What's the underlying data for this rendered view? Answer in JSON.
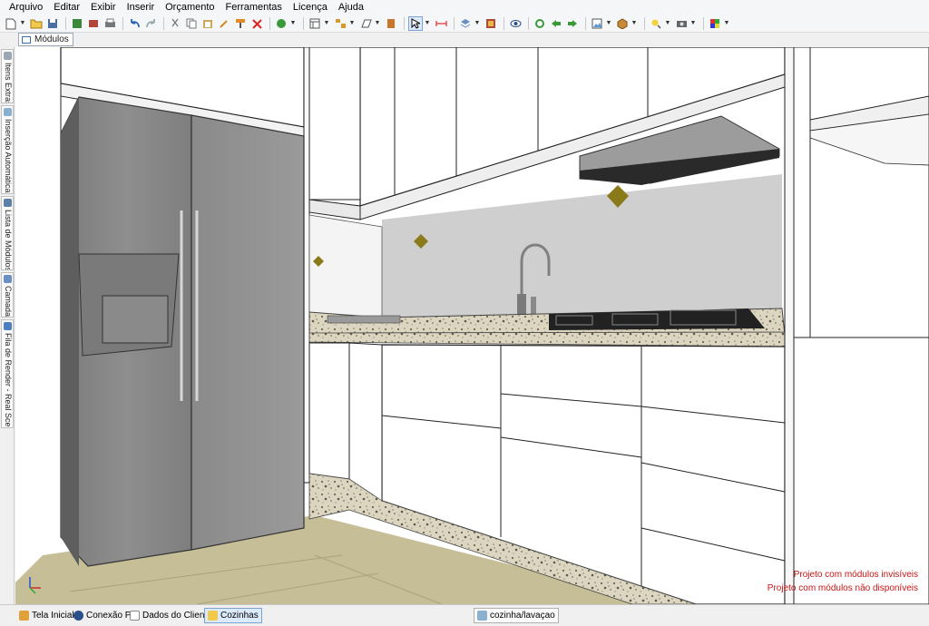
{
  "menu": [
    "Arquivo",
    "Editar",
    "Exibir",
    "Inserir",
    "Orçamento",
    "Ferramentas",
    "Licença",
    "Ajuda"
  ],
  "module_tab": {
    "label": "Módulos"
  },
  "sidebar_tabs": [
    "Itens Extras",
    "Inserção Automática",
    "Lista de Módulos",
    "Camadas",
    "Fila de Render - Real Scene"
  ],
  "status_messages": [
    "Projeto com módulos invisíveis",
    "Projeto com módulos não disponíveis"
  ],
  "taskbar": {
    "left": [
      "Tela Inicial",
      "Conexão P",
      "Dados do Cliente",
      "Cozinhas"
    ],
    "document": "cozinha/lavaçao"
  },
  "colors": {
    "status_text": "#c81414",
    "fridge": "#8a8a8a",
    "granite": "#d9d2bc",
    "floor": "#c6be96",
    "backsplash": "#cfcfcf"
  }
}
